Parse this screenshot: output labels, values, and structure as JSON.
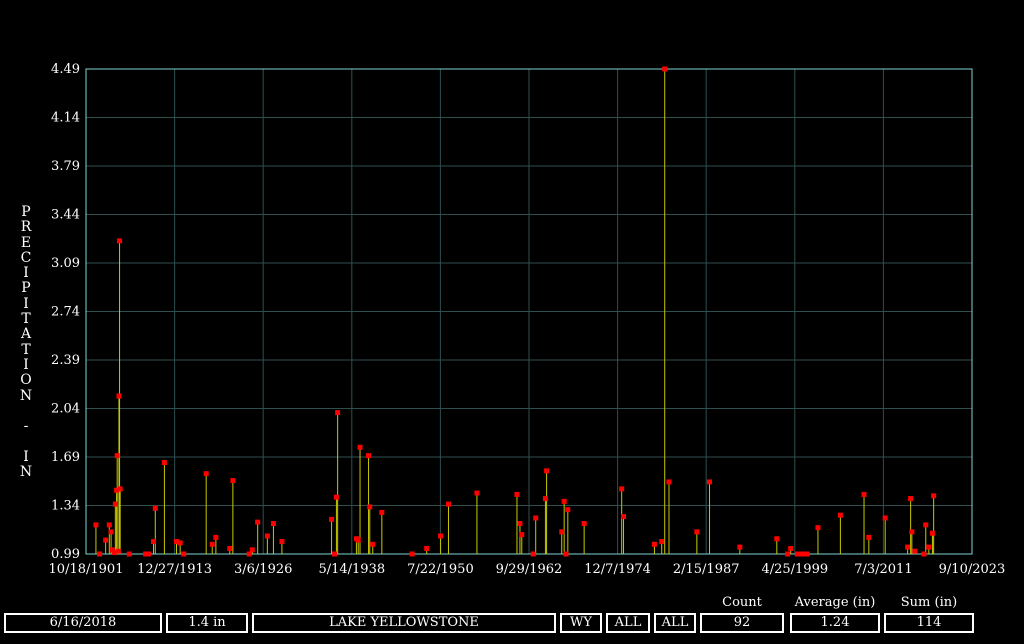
{
  "chart_data": {
    "type": "scatter",
    "ylabel": "PRECIPITATION - IN",
    "ylim": [
      0.99,
      4.49
    ],
    "xlim": [
      "1901-10-18",
      "2023-09-10"
    ],
    "x_ticks": [
      "10/18/1901",
      "12/27/1913",
      "3/6/1926",
      "5/14/1938",
      "7/22/1950",
      "9/29/1962",
      "12/7/1974",
      "2/15/1987",
      "4/25/1999",
      "7/3/2011",
      "9/10/2023"
    ],
    "y_ticks": [
      "0.99",
      "1.34",
      "1.69",
      "2.04",
      "2.39",
      "2.74",
      "3.09",
      "3.44",
      "3.79",
      "4.14",
      "4.49"
    ],
    "grid": true,
    "points": [
      {
        "x": "1903-03-01",
        "y": 1.2
      },
      {
        "x": "1903-09-01",
        "y": 0.99
      },
      {
        "x": "1904-07-01",
        "y": 1.09
      },
      {
        "x": "1905-01-01",
        "y": 1.2
      },
      {
        "x": "1905-04-01",
        "y": 1.15
      },
      {
        "x": "1905-06-01",
        "y": 1.02
      },
      {
        "x": "1905-09-01",
        "y": 1.0
      },
      {
        "x": "1905-11-01",
        "y": 1.35
      },
      {
        "x": "1906-01-01",
        "y": 1.45
      },
      {
        "x": "1906-02-01",
        "y": 1.7
      },
      {
        "x": "1906-04-01",
        "y": 1.01
      },
      {
        "x": "1906-05-01",
        "y": 2.13
      },
      {
        "x": "1906-06-01",
        "y": 3.25
      },
      {
        "x": "1906-07-01",
        "y": 1.46
      },
      {
        "x": "1907-10-01",
        "y": 0.99
      },
      {
        "x": "1910-01-01",
        "y": 0.99
      },
      {
        "x": "1911-02-01",
        "y": 1.08
      },
      {
        "x": "1911-05-01",
        "y": 1.32
      },
      {
        "x": "1912-08-01",
        "y": 1.65
      },
      {
        "x": "1914-04-01",
        "y": 1.08
      },
      {
        "x": "1914-10-01",
        "y": 1.07
      },
      {
        "x": "1915-04-01",
        "y": 0.99
      },
      {
        "x": "1918-05-01",
        "y": 1.57
      },
      {
        "x": "1919-03-01",
        "y": 1.06
      },
      {
        "x": "1919-09-01",
        "y": 1.11
      },
      {
        "x": "1921-08-01",
        "y": 1.03
      },
      {
        "x": "1922-01-01",
        "y": 1.52
      },
      {
        "x": "1924-04-01",
        "y": 0.99
      },
      {
        "x": "1924-09-01",
        "y": 1.02
      },
      {
        "x": "1925-06-01",
        "y": 1.22
      },
      {
        "x": "1926-10-01",
        "y": 1.12
      },
      {
        "x": "1927-08-01",
        "y": 1.21
      },
      {
        "x": "1928-10-01",
        "y": 1.08
      },
      {
        "x": "1935-08-01",
        "y": 1.24
      },
      {
        "x": "1936-04-01",
        "y": 1.4
      },
      {
        "x": "1936-06-01",
        "y": 2.01
      },
      {
        "x": "1939-01-01",
        "y": 1.1
      },
      {
        "x": "1939-04-01",
        "y": 1.09
      },
      {
        "x": "1939-07-01",
        "y": 1.76
      },
      {
        "x": "1940-09-01",
        "y": 1.7
      },
      {
        "x": "1940-11-01",
        "y": 1.33
      },
      {
        "x": "1941-04-01",
        "y": 1.06
      },
      {
        "x": "1942-07-01",
        "y": 1.29
      },
      {
        "x": "1946-09-01",
        "y": 0.99
      },
      {
        "x": "1948-09-01",
        "y": 1.03
      },
      {
        "x": "1950-08-01",
        "y": 1.12
      },
      {
        "x": "1951-09-01",
        "y": 1.35
      },
      {
        "x": "1955-08-01",
        "y": 1.43
      },
      {
        "x": "1961-02-01",
        "y": 1.42
      },
      {
        "x": "1961-07-01",
        "y": 1.21
      },
      {
        "x": "1961-10-01",
        "y": 1.13
      },
      {
        "x": "1963-05-01",
        "y": 0.99
      },
      {
        "x": "1963-09-01",
        "y": 1.25
      },
      {
        "x": "1965-01-01",
        "y": 1.39
      },
      {
        "x": "1965-03-01",
        "y": 1.59
      },
      {
        "x": "1967-04-01",
        "y": 1.15
      },
      {
        "x": "1967-08-01",
        "y": 1.37
      },
      {
        "x": "1967-11-01",
        "y": 0.99
      },
      {
        "x": "1968-02-01",
        "y": 1.31
      },
      {
        "x": "1970-05-01",
        "y": 1.21
      },
      {
        "x": "1975-07-01",
        "y": 1.46
      },
      {
        "x": "1975-10-01",
        "y": 1.26
      },
      {
        "x": "1980-01-01",
        "y": 1.06
      },
      {
        "x": "1981-01-01",
        "y": 1.08
      },
      {
        "x": "1981-06-01",
        "y": 4.49
      },
      {
        "x": "1982-01-01",
        "y": 1.51
      },
      {
        "x": "1985-11-01",
        "y": 1.15
      },
      {
        "x": "1987-08-01",
        "y": 1.51
      },
      {
        "x": "1991-10-01",
        "y": 1.04
      },
      {
        "x": "1996-11-01",
        "y": 1.1
      },
      {
        "x": "1998-05-01",
        "y": 0.99
      },
      {
        "x": "1998-10-01",
        "y": 1.03
      },
      {
        "x": "2000-01-01",
        "y": 0.99
      },
      {
        "x": "2000-06-01",
        "y": 0.99
      },
      {
        "x": "2001-01-01",
        "y": 0.99
      },
      {
        "x": "2002-07-01",
        "y": 1.18
      },
      {
        "x": "2005-08-01",
        "y": 1.27
      },
      {
        "x": "2008-11-01",
        "y": 1.42
      },
      {
        "x": "2009-07-01",
        "y": 1.11
      },
      {
        "x": "2011-10-01",
        "y": 1.25
      },
      {
        "x": "2014-11-01",
        "y": 1.04
      },
      {
        "x": "2015-04-01",
        "y": 1.39
      },
      {
        "x": "2015-06-01",
        "y": 1.15
      },
      {
        "x": "2015-11-01",
        "y": 1.01
      },
      {
        "x": "2017-02-01",
        "y": 0.99
      },
      {
        "x": "2017-05-01",
        "y": 1.2
      },
      {
        "x": "2017-10-01",
        "y": 1.04
      },
      {
        "x": "2018-04-01",
        "y": 1.14
      },
      {
        "x": "2018-06-01",
        "y": 1.41
      },
      {
        "x": "1910-06-01",
        "y": 0.99
      },
      {
        "x": "1999-09-01",
        "y": 0.99
      },
      {
        "x": "1936-01-01",
        "y": 0.99
      }
    ],
    "colors": {
      "stem": "#c8c800",
      "point": "#ff0000",
      "grid": "#2f4f4f",
      "axis": "#7fd4d4"
    }
  },
  "footer": {
    "date": "6/16/2018",
    "threshold": "1.4 in",
    "station": "LAKE YELLOWSTONE",
    "state": "WY",
    "filter1": "ALL",
    "filter2": "ALL",
    "count_label": "Count",
    "count": "92",
    "average_label": "Average (in)",
    "average": "1.24",
    "sum_label": "Sum (in)",
    "sum": "114"
  }
}
